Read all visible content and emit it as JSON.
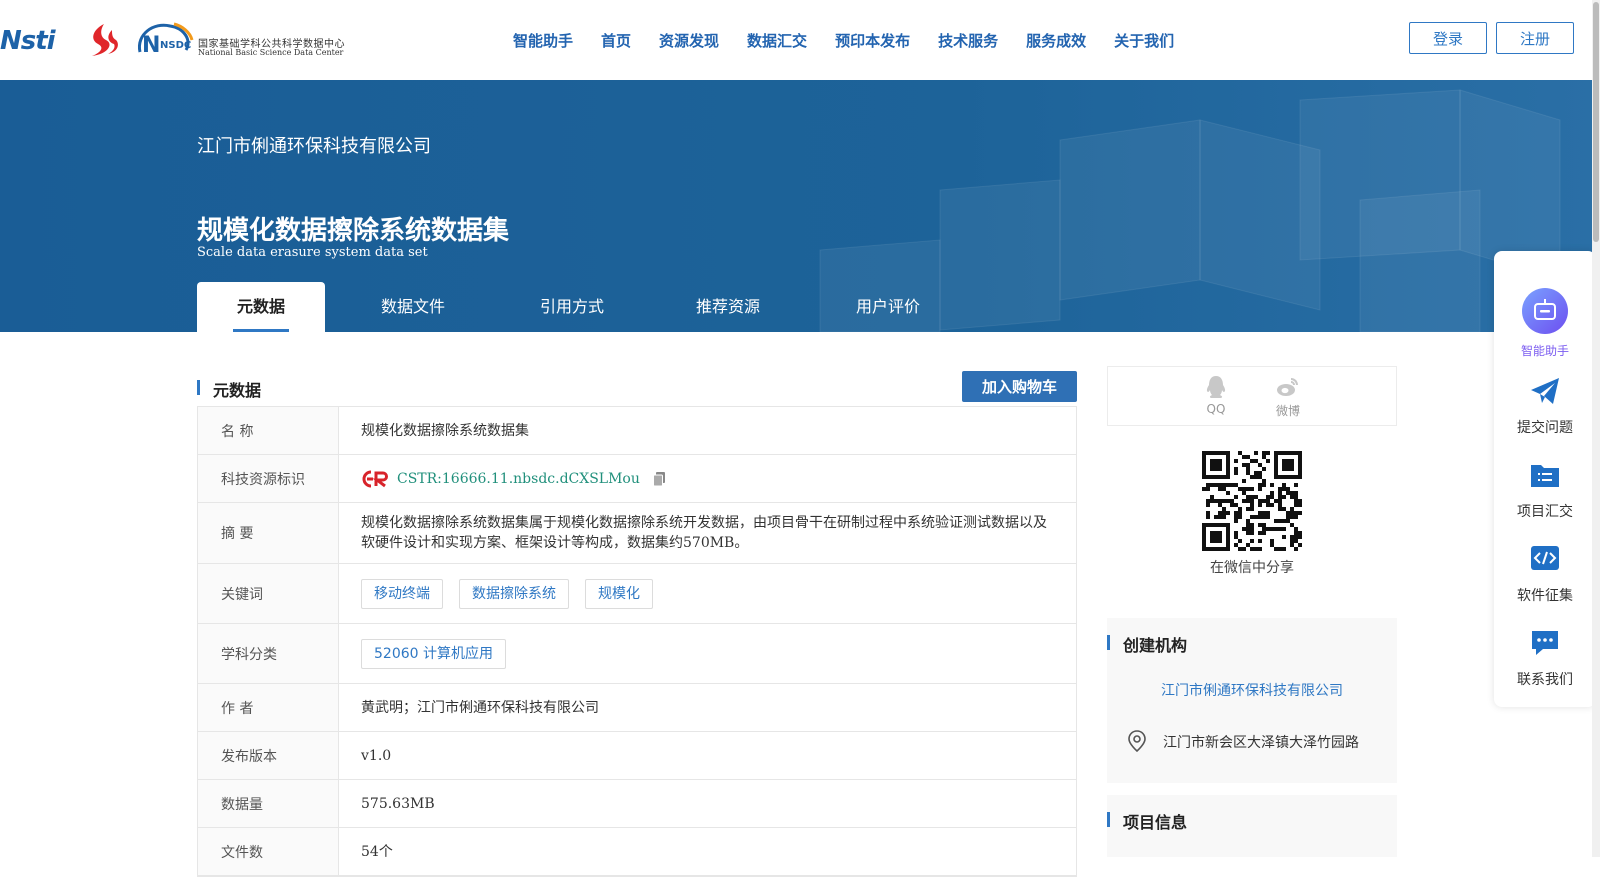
{
  "header": {
    "logo_text": "Nsti",
    "nsdc_abbr": "NSDC",
    "nsdc_cn": "国家基础学科公共科学数据中心",
    "nsdc_en": "National Basic Science Data Center",
    "nav": [
      "智能助手",
      "首页",
      "资源发现",
      "数据汇交",
      "预印本发布",
      "技术服务",
      "服务成效",
      "关于我们"
    ],
    "login": "登录",
    "register": "注册"
  },
  "banner": {
    "org": "江门市俐通环保科技有限公司",
    "title": "规模化数据擦除系统数据集",
    "subtitle": "Scale data erasure system data set",
    "tabs": [
      "元数据",
      "数据文件",
      "引用方式",
      "推荐资源",
      "用户评价"
    ]
  },
  "metadata": {
    "section_title": "元数据",
    "cart_button": "加入购物车",
    "rows": {
      "name": {
        "label": "名 称",
        "value": "规模化数据擦除系统数据集"
      },
      "cstr": {
        "label": "科技资源标识",
        "value": "CSTR:16666.11.nbsdc.dCXSLMou"
      },
      "abstract": {
        "label": "摘 要",
        "value": "规模化数据擦除系统数据集属于规模化数据擦除系统开发数据，由项目骨干在研制过程中系统验证测试数据以及软硬件设计和实现方案、框架设计等构成，数据集约570MB。"
      },
      "keywords": {
        "label": "关键词",
        "values": [
          "移动终端",
          "数据擦除系统",
          "规模化"
        ]
      },
      "subject": {
        "label": "学科分类",
        "value": "52060 计算机应用"
      },
      "author": {
        "label": "作 者",
        "value": "黄武明；江门市俐通环保科技有限公司"
      },
      "version": {
        "label": "发布版本",
        "value": "v1.0"
      },
      "size": {
        "label": "数据量",
        "value": "575.63MB"
      },
      "files": {
        "label": "文件数",
        "value": "54个"
      }
    }
  },
  "share": {
    "qq": "QQ",
    "weibo": "微博",
    "wechat_caption": "在微信中分享"
  },
  "org_section": {
    "title": "创建机构",
    "org_name": "江门市俐通环保科技有限公司",
    "address": "江门市新会区大泽镇大泽竹园路"
  },
  "project_section": {
    "title": "项目信息"
  },
  "side_panel": {
    "items": [
      "智能助手",
      "提交问题",
      "项目汇交",
      "软件征集",
      "联系我们"
    ]
  },
  "colors": {
    "brand_blue": "#2f78c4",
    "banner_blue": "#1c5f96",
    "cstr_green": "#21907c"
  }
}
